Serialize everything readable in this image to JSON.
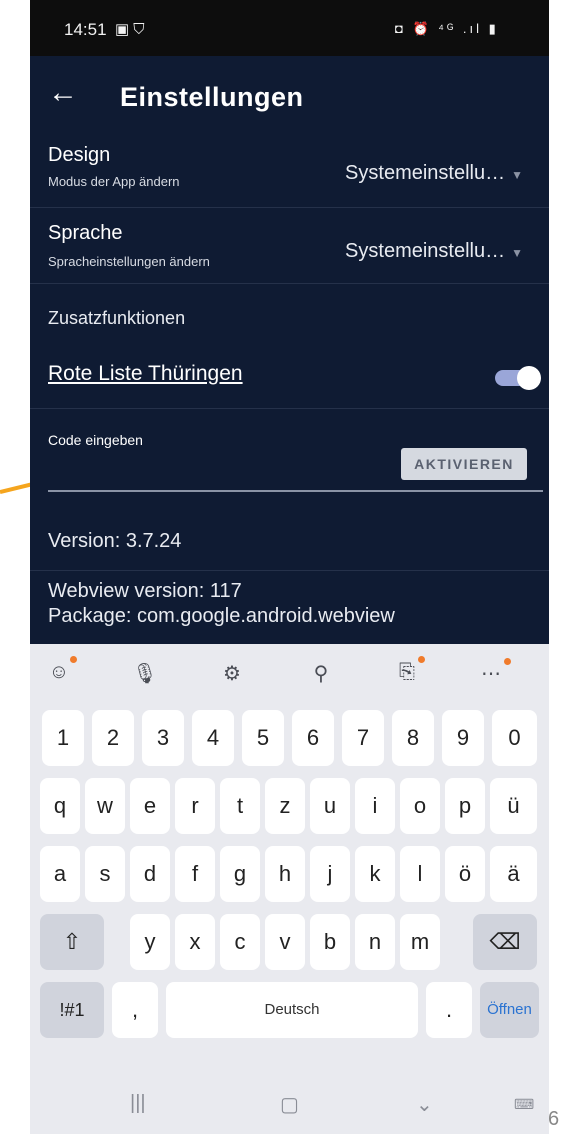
{
  "status_bar": {
    "time": "14:51",
    "left_icons": [
      "gallery-icon",
      "shield-icon"
    ],
    "right_icons_text": "◘ ⏰ ⁴ᴳ .ıl ▮"
  },
  "app_bar": {
    "back_icon": "arrow-left-icon",
    "title": "Einstellungen"
  },
  "settings": {
    "design": {
      "label": "Design",
      "sub": "Modus der App ändern",
      "value": "Systemeinstellu…"
    },
    "language": {
      "label": "Sprache",
      "sub": "Spracheinstellungen ändern",
      "value": "Systemeinstellu…"
    },
    "extras_header": "Zusatzfunktionen",
    "red_list_link": "Rote Liste Thüringen",
    "red_list_enabled": true,
    "code_label": "Code eingeben",
    "activate_button": "AKTIVIEREN",
    "version": "Version: 3.7.24",
    "webview_version": "Webview version: 117",
    "package": "Package: com.google.android.webview"
  },
  "keyboard": {
    "toolbar_icons": [
      "emoji-icon",
      "microphone-icon",
      "settings-icon",
      "search-icon",
      "clipboard-translate-icon",
      "more-icon"
    ],
    "row_numbers": [
      "1",
      "2",
      "3",
      "4",
      "5",
      "6",
      "7",
      "8",
      "9",
      "0"
    ],
    "row_qwertz": [
      "q",
      "w",
      "e",
      "r",
      "t",
      "z",
      "u",
      "i",
      "o",
      "p",
      "ü"
    ],
    "row_asdf": [
      "a",
      "s",
      "d",
      "f",
      "g",
      "h",
      "j",
      "k",
      "l",
      "ö",
      "ä"
    ],
    "row_yxcv": [
      "y",
      "x",
      "c",
      "v",
      "b",
      "n",
      "m"
    ],
    "symbols_key": "!#1",
    "comma_key": ",",
    "space_label": "Deutsch",
    "period_key": ".",
    "enter_label": "Öffnen"
  },
  "navbar": {
    "items": [
      "recent-apps-icon",
      "home-icon",
      "back-chevron-icon",
      "keyboard-switch-icon"
    ]
  },
  "corner_text": "6",
  "colors": {
    "app_background": "#0f1b33",
    "annotation_arrow": "#f5a51e",
    "toggle_track": "#9aa6d8",
    "enter_text": "#2b73d1"
  }
}
